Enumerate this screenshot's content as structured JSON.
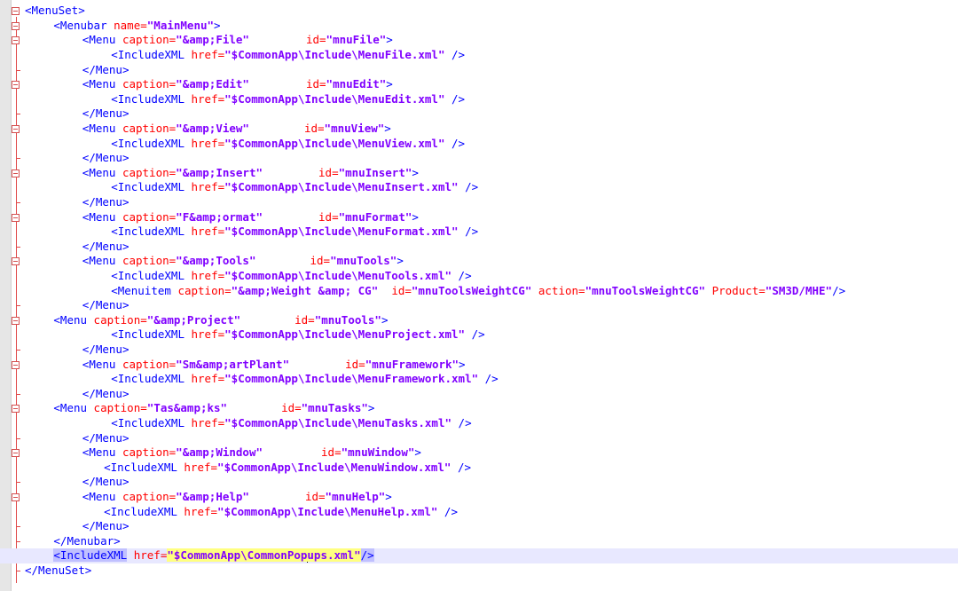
{
  "editor": {
    "lines": [
      {
        "indent": 0,
        "fold": "open",
        "segs": [
          [
            "tag",
            "<MenuSet>"
          ]
        ]
      },
      {
        "indent": 4,
        "fold": "open",
        "segs": [
          [
            "tag",
            "<Menubar "
          ],
          [
            "attr",
            "name="
          ],
          [
            "val",
            "\"MainMenu\""
          ],
          [
            "tag",
            ">"
          ]
        ]
      },
      {
        "indent": 8,
        "fold": "open",
        "segs": [
          [
            "tag",
            "<Menu "
          ],
          [
            "attr",
            "caption="
          ],
          [
            "val",
            "\"&amp;File\""
          ],
          [
            "gap",
            64
          ],
          [
            "attr",
            "id="
          ],
          [
            "val",
            "\"mnuFile\""
          ],
          [
            "tag",
            ">"
          ]
        ]
      },
      {
        "indent": 12,
        "segs": [
          [
            "tag",
            "<IncludeXML "
          ],
          [
            "attr",
            "href="
          ],
          [
            "val",
            "\"$CommonApp\\Include\\MenuFile.xml\""
          ],
          [
            "tag",
            " />"
          ]
        ]
      },
      {
        "indent": 8,
        "end": true,
        "segs": [
          [
            "tag",
            "</Menu>"
          ]
        ]
      },
      {
        "indent": 8,
        "fold": "open",
        "segs": [
          [
            "tag",
            "<Menu "
          ],
          [
            "attr",
            "caption="
          ],
          [
            "val",
            "\"&amp;Edit\""
          ],
          [
            "gap",
            64
          ],
          [
            "attr",
            "id="
          ],
          [
            "val",
            "\"mnuEdit\""
          ],
          [
            "tag",
            ">"
          ]
        ]
      },
      {
        "indent": 12,
        "segs": [
          [
            "tag",
            "<IncludeXML "
          ],
          [
            "attr",
            "href="
          ],
          [
            "val",
            "\"$CommonApp\\Include\\MenuEdit.xml\""
          ],
          [
            "tag",
            " />"
          ]
        ]
      },
      {
        "indent": 8,
        "end": true,
        "segs": [
          [
            "tag",
            "</Menu>"
          ]
        ]
      },
      {
        "indent": 8,
        "fold": "open",
        "segs": [
          [
            "tag",
            "<Menu "
          ],
          [
            "attr",
            "caption="
          ],
          [
            "val",
            "\"&amp;View\""
          ],
          [
            "gap",
            62
          ],
          [
            "attr",
            "id="
          ],
          [
            "val",
            "\"mnuView\""
          ],
          [
            "tag",
            ">"
          ]
        ]
      },
      {
        "indent": 12,
        "segs": [
          [
            "tag",
            "<IncludeXML "
          ],
          [
            "attr",
            "href="
          ],
          [
            "val",
            "\"$CommonApp\\Include\\MenuView.xml\""
          ],
          [
            "tag",
            " />"
          ]
        ]
      },
      {
        "indent": 8,
        "end": true,
        "segs": [
          [
            "tag",
            "</Menu>"
          ]
        ]
      },
      {
        "indent": 8,
        "fold": "open",
        "segs": [
          [
            "tag",
            "<Menu "
          ],
          [
            "attr",
            "caption="
          ],
          [
            "val",
            "\"&amp;Insert\""
          ],
          [
            "gap",
            63
          ],
          [
            "attr",
            "id="
          ],
          [
            "val",
            "\"mnuInsert\""
          ],
          [
            "tag",
            ">"
          ]
        ]
      },
      {
        "indent": 12,
        "segs": [
          [
            "tag",
            "<IncludeXML "
          ],
          [
            "attr",
            "href="
          ],
          [
            "val",
            "\"$CommonApp\\Include\\MenuInsert.xml\""
          ],
          [
            "tag",
            " />"
          ]
        ]
      },
      {
        "indent": 8,
        "end": true,
        "segs": [
          [
            "tag",
            "</Menu>"
          ]
        ]
      },
      {
        "indent": 8,
        "fold": "open",
        "segs": [
          [
            "tag",
            "<Menu "
          ],
          [
            "attr",
            "caption="
          ],
          [
            "val",
            "\"F&amp;ormat\""
          ],
          [
            "gap",
            63
          ],
          [
            "attr",
            "id="
          ],
          [
            "val",
            "\"mnuFormat\""
          ],
          [
            "tag",
            ">"
          ]
        ]
      },
      {
        "indent": 12,
        "segs": [
          [
            "tag",
            "<IncludeXML "
          ],
          [
            "attr",
            "href="
          ],
          [
            "val",
            "\"$CommonApp\\Include\\MenuFormat.xml\""
          ],
          [
            "tag",
            " />"
          ]
        ]
      },
      {
        "indent": 8,
        "end": true,
        "segs": [
          [
            "tag",
            "</Menu>"
          ]
        ]
      },
      {
        "indent": 8,
        "fold": "open",
        "segs": [
          [
            "tag",
            "<Menu "
          ],
          [
            "attr",
            "caption="
          ],
          [
            "val",
            "\"&amp;Tools\""
          ],
          [
            "gap",
            61
          ],
          [
            "attr",
            "id="
          ],
          [
            "val",
            "\"mnuTools\""
          ],
          [
            "tag",
            ">"
          ]
        ]
      },
      {
        "indent": 12,
        "segs": [
          [
            "tag",
            "<IncludeXML "
          ],
          [
            "attr",
            "href="
          ],
          [
            "val",
            "\"$CommonApp\\Include\\MenuTools.xml\""
          ],
          [
            "tag",
            " />"
          ]
        ]
      },
      {
        "indent": 12,
        "segs": [
          [
            "tag",
            "<Menuitem "
          ],
          [
            "attr",
            "caption="
          ],
          [
            "val",
            "\"&amp;Weight &amp; CG\""
          ],
          [
            "tag",
            "  "
          ],
          [
            "attr",
            "id="
          ],
          [
            "val",
            "\"mnuToolsWeightCG\""
          ],
          [
            "tag",
            " "
          ],
          [
            "attr",
            "action="
          ],
          [
            "val",
            "\"mnuToolsWeightCG\""
          ],
          [
            "tag",
            " "
          ],
          [
            "attr",
            "Product="
          ],
          [
            "val",
            "\"SM3D/MHE\""
          ],
          [
            "tag",
            "/>"
          ]
        ]
      },
      {
        "indent": 8,
        "end": true,
        "segs": [
          [
            "tag",
            "</Menu>"
          ]
        ]
      },
      {
        "indent": 4,
        "fold": "open",
        "segs": [
          [
            "tag",
            "<Menu "
          ],
          [
            "attr",
            "caption="
          ],
          [
            "val",
            "\"&amp;Project\""
          ],
          [
            "gap",
            61
          ],
          [
            "attr",
            "id="
          ],
          [
            "val",
            "\"mnuTools\""
          ],
          [
            "tag",
            ">"
          ]
        ]
      },
      {
        "indent": 12,
        "segs": [
          [
            "tag",
            "<IncludeXML "
          ],
          [
            "attr",
            "href="
          ],
          [
            "val",
            "\"$CommonApp\\Include\\MenuProject.xml\""
          ],
          [
            "tag",
            " />"
          ]
        ]
      },
      {
        "indent": 8,
        "end": true,
        "segs": [
          [
            "tag",
            "</Menu>"
          ]
        ]
      },
      {
        "indent": 8,
        "fold": "open",
        "segs": [
          [
            "tag",
            "<Menu "
          ],
          [
            "attr",
            "caption="
          ],
          [
            "val",
            "\"Sm&amp;artPlant\""
          ],
          [
            "gap",
            63
          ],
          [
            "attr",
            "id="
          ],
          [
            "val",
            "\"mnuFramework\""
          ],
          [
            "tag",
            ">"
          ]
        ]
      },
      {
        "indent": 12,
        "segs": [
          [
            "tag",
            "<IncludeXML "
          ],
          [
            "attr",
            "href="
          ],
          [
            "val",
            "\"$CommonApp\\Include\\MenuFramework.xml\""
          ],
          [
            "tag",
            " />"
          ]
        ]
      },
      {
        "indent": 8,
        "end": true,
        "segs": [
          [
            "tag",
            "</Menu>"
          ]
        ]
      },
      {
        "indent": 4,
        "fold": "open",
        "segs": [
          [
            "tag",
            "<Menu "
          ],
          [
            "attr",
            "caption="
          ],
          [
            "val",
            "\"Tas&amp;ks\""
          ],
          [
            "gap",
            61
          ],
          [
            "attr",
            "id="
          ],
          [
            "val",
            "\"mnuTasks\""
          ],
          [
            "tag",
            ">"
          ]
        ]
      },
      {
        "indent": 12,
        "segs": [
          [
            "tag",
            "<IncludeXML "
          ],
          [
            "attr",
            "href="
          ],
          [
            "val",
            "\"$CommonApp\\Include\\MenuTasks.xml\""
          ],
          [
            "tag",
            " />"
          ]
        ]
      },
      {
        "indent": 8,
        "end": true,
        "segs": [
          [
            "tag",
            "</Menu>"
          ]
        ]
      },
      {
        "indent": 8,
        "fold": "open",
        "segs": [
          [
            "tag",
            "<Menu "
          ],
          [
            "attr",
            "caption="
          ],
          [
            "val",
            "\"&amp;Window\""
          ],
          [
            "gap",
            66
          ],
          [
            "attr",
            "id="
          ],
          [
            "val",
            "\"mnuWindow\""
          ],
          [
            "tag",
            ">"
          ]
        ]
      },
      {
        "indent": 11,
        "segs": [
          [
            "tag",
            "<IncludeXML "
          ],
          [
            "attr",
            "href="
          ],
          [
            "val",
            "\"$CommonApp\\Include\\MenuWindow.xml\""
          ],
          [
            "tag",
            " />"
          ]
        ]
      },
      {
        "indent": 8,
        "end": true,
        "segs": [
          [
            "tag",
            "</Menu>"
          ]
        ]
      },
      {
        "indent": 8,
        "fold": "open",
        "segs": [
          [
            "tag",
            "<Menu "
          ],
          [
            "attr",
            "caption="
          ],
          [
            "val",
            "\"&amp;Help\""
          ],
          [
            "gap",
            63
          ],
          [
            "attr",
            "id="
          ],
          [
            "val",
            "\"mnuHelp\""
          ],
          [
            "tag",
            ">"
          ]
        ]
      },
      {
        "indent": 11,
        "segs": [
          [
            "tag",
            "<IncludeXML "
          ],
          [
            "attr",
            "href="
          ],
          [
            "val",
            "\"$CommonApp\\Include\\MenuHelp.xml\""
          ],
          [
            "tag",
            " />"
          ]
        ]
      },
      {
        "indent": 8,
        "end": true,
        "segs": [
          [
            "tag",
            "</Menu>"
          ]
        ]
      },
      {
        "indent": 4,
        "end": true,
        "segs": [
          [
            "tag",
            "</Menubar>"
          ]
        ]
      },
      {
        "indent": 4,
        "current": true,
        "segs": [
          [
            "tag-hl",
            "<IncludeXML"
          ],
          [
            "tag",
            " "
          ],
          [
            "attr",
            "href="
          ],
          [
            "val-hl",
            "\"$CommonApp\\CommonPop"
          ],
          [
            "caret",
            ""
          ],
          [
            "val-hl",
            "ups.xml\""
          ],
          [
            "tag-hl",
            "/>"
          ]
        ]
      },
      {
        "indent": 0,
        "end": true,
        "last": true,
        "segs": [
          [
            "tag",
            "</MenuSet>"
          ]
        ]
      }
    ]
  }
}
